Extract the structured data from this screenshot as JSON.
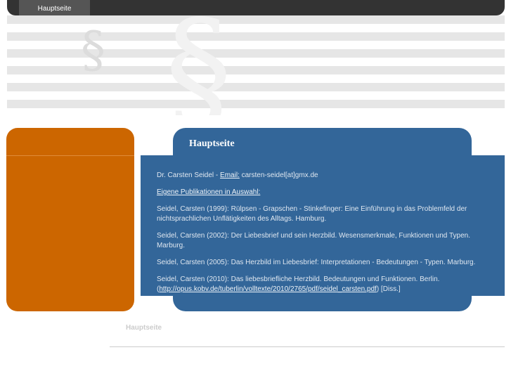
{
  "nav": {
    "home_label": "Hauptseite"
  },
  "banner": {
    "symbol": "§"
  },
  "content": {
    "heading": "Hauptseite",
    "contact": {
      "name_prefix": "Dr. Carsten Seidel  - ",
      "email_label": "Email:",
      "email_value": " carsten-seidel[at]gmx.de"
    },
    "publications_heading": "Eigene Publikationen in Auswahl:",
    "pub1": "Seidel, Carsten (1999): Rülpsen - Grapschen - Stinkefinger: Eine Einführung in das Problemfeld der nichtsprachlichen Unflätigkeiten des Alltags. Hamburg.",
    "pub2": "Seidel, Carsten (2002): Der Liebesbrief und sein Herzbild. Wesensmerkmale, Funktionen und Typen. Marburg.",
    "pub3": "Seidel, Carsten (2005): Das Herzbild im Liebesbrief: Interpretationen - Bedeutungen - Typen. Marburg.",
    "pub4": {
      "text": "Seidel, Carsten (2010): Das liebesbriefliche Herzbild. Bedeutungen und Funktionen. Berlin. (",
      "link": "http://opus.kobv.de/tuberlin/volltexte/2010/2765/pdf/seidel_carsten.pdf",
      "suffix": ") [Diss.]"
    }
  },
  "footer": {
    "label": "Hauptseite"
  },
  "colors": {
    "topbar": "#333333",
    "sidebar": "#cc6600",
    "content": "#336699"
  }
}
